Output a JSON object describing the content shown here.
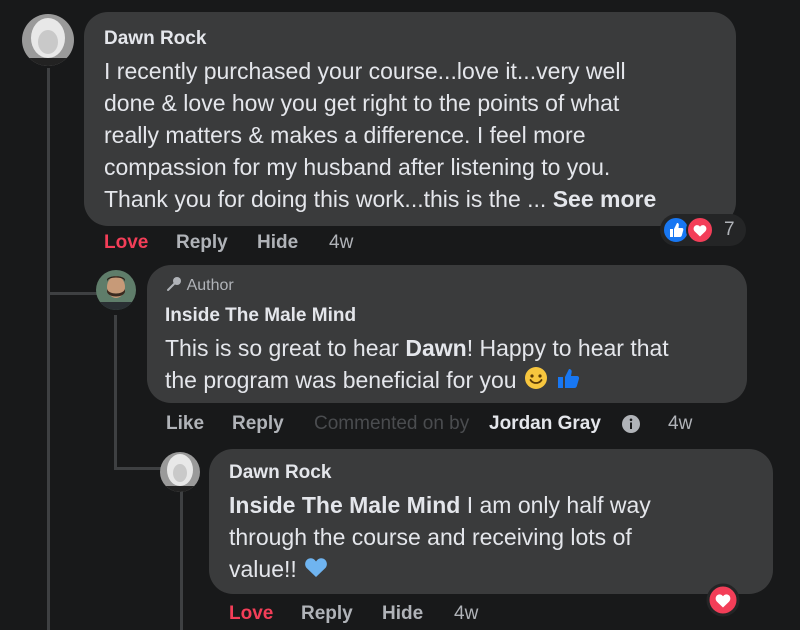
{
  "comments": {
    "c1": {
      "author": "Dawn Rock",
      "lines": [
        "I recently purchased your course...love it...very well",
        "done & love how you get right to the points of what",
        "really matters & makes a difference. I feel more",
        "compassion for my husband after listening to you.",
        "Thank you for doing this work...this is the ..."
      ],
      "see_more": "See more",
      "actions": {
        "love": "Love",
        "reply": "Reply",
        "hide": "Hide",
        "time": "4w"
      },
      "reaction_count": "7"
    },
    "c2": {
      "badge": "Author",
      "author": "Inside The Male Mind",
      "line1_pre": "This is so great to hear ",
      "line1_bold": "Dawn",
      "line1_post": "! Happy to hear that",
      "line2": "the program was beneficial for you",
      "actions": {
        "like": "Like",
        "reply": "Reply",
        "commented_by": "Commented on by",
        "commenter": "Jordan Gray",
        "time": "4w"
      }
    },
    "c3": {
      "author": "Dawn Rock",
      "mention": "Inside The Male Mind",
      "line1_post": " I am only half way",
      "line2": "through the course and receiving lots of",
      "line3": "value!!",
      "actions": {
        "love": "Love",
        "reply": "Reply",
        "hide": "Hide",
        "time": "4w"
      }
    }
  },
  "colors": {
    "background": "#18191a",
    "bubble": "#3a3b3c",
    "love": "#f33e58",
    "like_blue": "#1877f2",
    "secondary_text": "#b0b3b8"
  },
  "icons": {
    "author_badge": "microphone-icon",
    "info": "info-icon",
    "like": "thumbs-up-icon",
    "heart": "heart-icon",
    "smile": "smile-emoji-icon",
    "blue_heart": "blue-heart-emoji-icon"
  }
}
